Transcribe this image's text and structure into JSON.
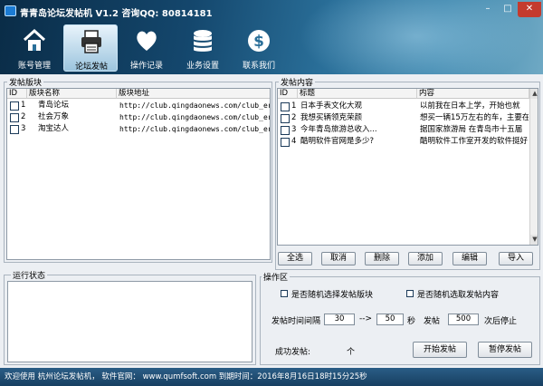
{
  "window": {
    "title": "青青岛论坛发帖机 V1.2 咨询QQ: 80814181"
  },
  "toolbar": {
    "items": [
      {
        "label": "账号管理",
        "icon": "home-icon"
      },
      {
        "label": "论坛发帖",
        "icon": "printer-icon"
      },
      {
        "label": "操作记录",
        "icon": "heart-icon"
      },
      {
        "label": "业务设置",
        "icon": "coins-icon"
      },
      {
        "label": "联系我们",
        "icon": "dollar-icon"
      }
    ],
    "selected": "论坛发帖"
  },
  "sections": {
    "forums": {
      "title": "发帖版块",
      "columns": [
        "ID",
        "版块名称",
        "版块地址"
      ],
      "rows": [
        {
          "id": "1",
          "name": "青岛论坛",
          "url": "http://club.qingdaonews.com/club_er"
        },
        {
          "id": "2",
          "name": "社会万象",
          "url": "http://club.qingdaonews.com/club_er"
        },
        {
          "id": "3",
          "name": "淘宝达人",
          "url": "http://club.qingdaonews.com/club_er"
        }
      ]
    },
    "posts": {
      "title": "发帖内容",
      "columns": [
        "ID",
        "标题",
        "内容"
      ],
      "rows": [
        {
          "id": "1",
          "title": "日本手表文化大观",
          "content": "以前我在日本上学，开始也就"
        },
        {
          "id": "2",
          "title": "我想买辆领克荣颜",
          "content": "想买一辆15万左右的车，主要在"
        },
        {
          "id": "3",
          "title": "今年青岛旅游总收入...",
          "content": "据国家旅游局 在青岛市十五届"
        },
        {
          "id": "4",
          "title": "酷明软件官网是多少?",
          "content": "酷明软件工作室开发的软件挺好"
        }
      ],
      "buttons": [
        "全选",
        "取消",
        "删除",
        "添加",
        "编辑",
        "导入"
      ]
    },
    "run_status": {
      "title": "运行状态"
    },
    "operation": {
      "title": "操作区",
      "random_forum_label": "是否随机选择发帖版块",
      "random_content_label": "是否随机选取发帖内容",
      "interval_label": "发帖时间间隔",
      "interval_min": "30",
      "interval_sep": "-->",
      "interval_max": "50",
      "seconds_unit": "秒",
      "post_label": "发帖",
      "post_count": "500",
      "stop_suffix": "次后停止",
      "success_label": "成功发帖:",
      "success_unit": "个",
      "start_button": "开始发帖",
      "stop_button": "暂停发帖"
    }
  },
  "statusbar": {
    "text": "欢迎使用 杭州论坛发帖机， 软件官网： www.qumfsoft.com  到期时间：2016年8月16日18时15分25秒"
  },
  "colors": {
    "header_dark": "#0a2c47",
    "header_light": "#6fa9c4",
    "status_bar": "#1f4d74",
    "close_button": "#c43b2e"
  }
}
